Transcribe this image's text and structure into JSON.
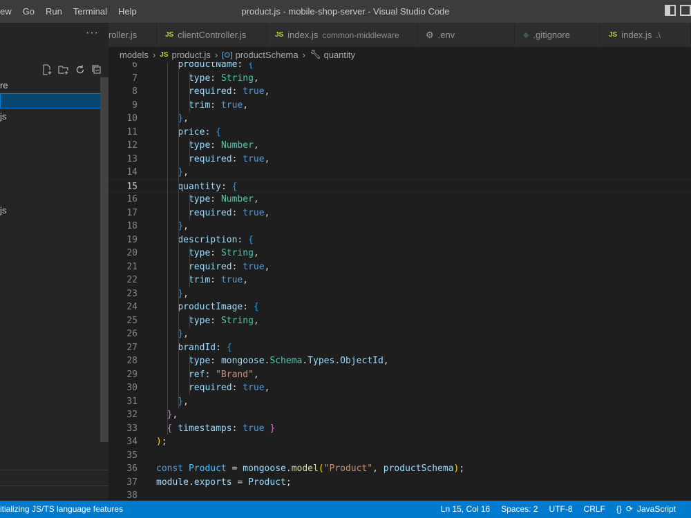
{
  "window": {
    "title": "product.js - mobile-shop-server - Visual Studio Code",
    "menu": [
      "ew",
      "Go",
      "Run",
      "Terminal",
      "Help"
    ]
  },
  "sidebar": {
    "more": "···",
    "items": [
      {
        "label": "re",
        "selected": false
      },
      {
        "label": "",
        "selected": true
      },
      {
        "label": "js",
        "selected": false
      },
      {
        "label": "js",
        "selected": false
      }
    ]
  },
  "tabs": [
    {
      "label": "roller.js",
      "icon": "",
      "desc": ""
    },
    {
      "label": "clientController.js",
      "icon": "JS",
      "desc": ""
    },
    {
      "label": "index.js",
      "icon": "JS",
      "desc": "common-middleware"
    },
    {
      "label": ".env",
      "icon": "gear-icon",
      "desc": ""
    },
    {
      "label": ".gitignore",
      "icon": "git-icon",
      "desc": ""
    },
    {
      "label": "index.js",
      "icon": "JS",
      "desc": ".\\"
    }
  ],
  "breadcrumb": {
    "folder": "models",
    "file": "product.js",
    "file_icon": "JS",
    "symbol": "productSchema",
    "property": "quantity"
  },
  "editor": {
    "current_line": 15,
    "lines": [
      {
        "n": "6",
        "html": "    <span class=\"k\">productName</span>: <span class=\"bl\">{</span>"
      },
      {
        "n": "7",
        "html": "      <span class=\"k\">type</span>: <span class=\"t\">String</span>,"
      },
      {
        "n": "8",
        "html": "      <span class=\"k\">required</span>: <span class=\"b\">true</span>,"
      },
      {
        "n": "9",
        "html": "      <span class=\"k\">trim</span>: <span class=\"b\">true</span>,"
      },
      {
        "n": "10",
        "html": "    <span class=\"bl\">}</span>,"
      },
      {
        "n": "11",
        "html": "    <span class=\"k\">price</span>: <span class=\"bl\">{</span>"
      },
      {
        "n": "12",
        "html": "      <span class=\"k\">type</span>: <span class=\"t\">Number</span>,"
      },
      {
        "n": "13",
        "html": "      <span class=\"k\">required</span>: <span class=\"b\">true</span>,"
      },
      {
        "n": "14",
        "html": "    <span class=\"bl\">}</span>,"
      },
      {
        "n": "15",
        "html": "    <span class=\"k\">quantity</span>: <span class=\"bl\">{</span>"
      },
      {
        "n": "16",
        "html": "      <span class=\"k\">type</span>: <span class=\"t\">Number</span>,"
      },
      {
        "n": "17",
        "html": "      <span class=\"k\">required</span>: <span class=\"b\">true</span>,"
      },
      {
        "n": "18",
        "html": "    <span class=\"bl\">}</span>,"
      },
      {
        "n": "19",
        "html": "    <span class=\"k\">description</span>: <span class=\"bl\">{</span>"
      },
      {
        "n": "20",
        "html": "      <span class=\"k\">type</span>: <span class=\"t\">String</span>,"
      },
      {
        "n": "21",
        "html": "      <span class=\"k\">required</span>: <span class=\"b\">true</span>,"
      },
      {
        "n": "22",
        "html": "      <span class=\"k\">trim</span>: <span class=\"b\">true</span>,"
      },
      {
        "n": "23",
        "html": "    <span class=\"bl\">}</span>,"
      },
      {
        "n": "24",
        "html": "    <span class=\"k\">productImage</span>: <span class=\"bl\">{</span>"
      },
      {
        "n": "25",
        "html": "      <span class=\"k\">type</span>: <span class=\"t\">String</span>,"
      },
      {
        "n": "26",
        "html": "    <span class=\"bl\">}</span>,"
      },
      {
        "n": "27",
        "html": "    <span class=\"k\">brandId</span>: <span class=\"bl\">{</span>"
      },
      {
        "n": "28",
        "html": "      <span class=\"k\">type</span>: <span class=\"k\">mongoose</span>.<span class=\"t\">Schema</span>.<span class=\"k\">Types</span>.<span class=\"k\">ObjectId</span>,"
      },
      {
        "n": "29",
        "html": "      <span class=\"k\">ref</span>: <span class=\"s\">\"Brand\"</span>,"
      },
      {
        "n": "30",
        "html": "      <span class=\"k\">required</span>: <span class=\"b\">true</span>,"
      },
      {
        "n": "31",
        "html": "    <span class=\"bl\">}</span>,"
      },
      {
        "n": "32",
        "html": "  <span class=\"p\">}</span>,"
      },
      {
        "n": "33",
        "html": "  <span class=\"p\">{</span> <span class=\"k\">timestamps</span>: <span class=\"b\">true</span> <span class=\"p\">}</span>"
      },
      {
        "n": "34",
        "html": "<span class=\"y\">)</span>;"
      },
      {
        "n": "35",
        "html": ""
      },
      {
        "n": "36",
        "html": "<span class=\"b\">const</span> <span class=\"c\">Product</span> = <span class=\"k\">mongoose</span>.<span class=\"f\">model</span><span class=\"y\">(</span><span class=\"s\">\"Product\"</span>, <span class=\"k\">productSchema</span><span class=\"y\">)</span>;"
      },
      {
        "n": "37",
        "html": "<span class=\"k\">module</span>.<span class=\"k\">exports</span> = <span class=\"k\">Product</span>;"
      },
      {
        "n": "38",
        "html": ""
      }
    ]
  },
  "statusbar": {
    "left": "itializing JS/TS language features",
    "position": "Ln 15, Col 16",
    "spaces": "Spaces: 2",
    "encoding": "UTF-8",
    "eol": "CRLF",
    "braces": "{}",
    "sync": "⟳",
    "language": "JavaScript"
  }
}
